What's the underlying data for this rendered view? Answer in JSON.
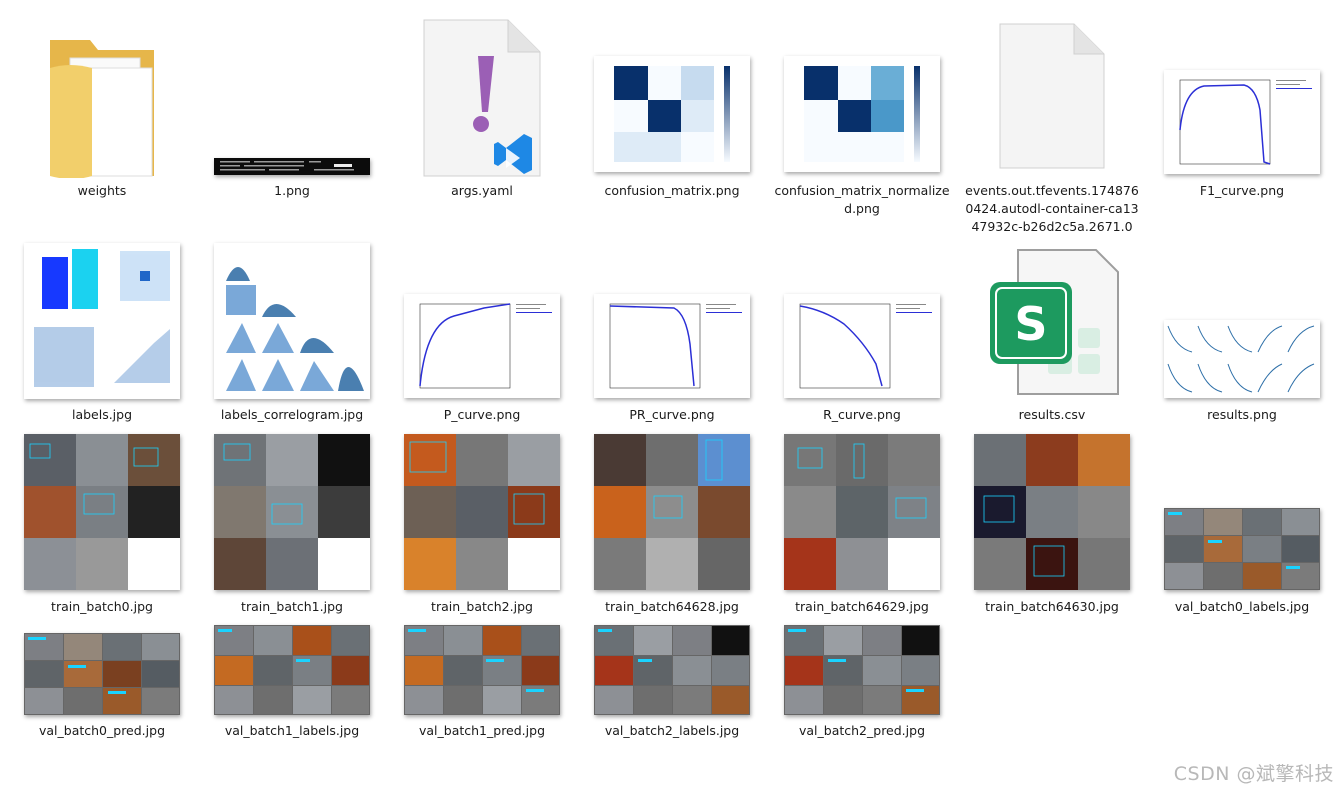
{
  "files": [
    {
      "key": "weights",
      "name": "weights",
      "icon": "folder-icon"
    },
    {
      "key": "img1",
      "name": "1.png",
      "icon": "terminal-screenshot-thumbnail"
    },
    {
      "key": "args",
      "name": "args.yaml",
      "icon": "yaml-file-icon"
    },
    {
      "key": "cm",
      "name": "confusion_matrix.png",
      "icon": "confusion-matrix-thumbnail"
    },
    {
      "key": "cmn",
      "name": "confusion_matrix_normalized.png",
      "icon": "confusion-matrix-normalized-thumbnail"
    },
    {
      "key": "events",
      "name": "events.out.tfevents.1748760424.autodl-container-ca1347932c-b26d2c5a.2671.0",
      "icon": "blank-file-icon"
    },
    {
      "key": "f1",
      "name": "F1_curve.png",
      "icon": "f1-curve-thumbnail"
    },
    {
      "key": "labels",
      "name": "labels.jpg",
      "icon": "labels-thumbnail"
    },
    {
      "key": "corr",
      "name": "labels_correlogram.jpg",
      "icon": "correlogram-thumbnail"
    },
    {
      "key": "p",
      "name": "P_curve.png",
      "icon": "p-curve-thumbnail"
    },
    {
      "key": "pr",
      "name": "PR_curve.png",
      "icon": "pr-curve-thumbnail"
    },
    {
      "key": "r",
      "name": "R_curve.png",
      "icon": "r-curve-thumbnail"
    },
    {
      "key": "csv",
      "name": "results.csv",
      "icon": "spreadsheet-file-icon"
    },
    {
      "key": "res",
      "name": "results.png",
      "icon": "results-thumbnail"
    },
    {
      "key": "tb0",
      "name": "train_batch0.jpg",
      "icon": "train-batch-thumbnail"
    },
    {
      "key": "tb1",
      "name": "train_batch1.jpg",
      "icon": "train-batch-thumbnail"
    },
    {
      "key": "tb2",
      "name": "train_batch2.jpg",
      "icon": "train-batch-thumbnail"
    },
    {
      "key": "tb64628",
      "name": "train_batch64628.jpg",
      "icon": "train-batch-thumbnail"
    },
    {
      "key": "tb64629",
      "name": "train_batch64629.jpg",
      "icon": "train-batch-thumbnail"
    },
    {
      "key": "tb64630",
      "name": "train_batch64630.jpg",
      "icon": "train-batch-thumbnail"
    },
    {
      "key": "vb0l",
      "name": "val_batch0_labels.jpg",
      "icon": "val-batch-thumbnail"
    },
    {
      "key": "vb0p",
      "name": "val_batch0_pred.jpg",
      "icon": "val-batch-thumbnail"
    },
    {
      "key": "vb1l",
      "name": "val_batch1_labels.jpg",
      "icon": "val-batch-thumbnail"
    },
    {
      "key": "vb1p",
      "name": "val_batch1_pred.jpg",
      "icon": "val-batch-thumbnail"
    },
    {
      "key": "vb2l",
      "name": "val_batch2_labels.jpg",
      "icon": "val-batch-thumbnail"
    },
    {
      "key": "vb2p",
      "name": "val_batch2_pred.jpg",
      "icon": "val-batch-thumbnail"
    }
  ],
  "watermark": "CSDN @斌擎科技",
  "colors": {
    "folder": "#f2cf6b",
    "yaml_mark": "#9b5fb5",
    "vscode": "#1e88e5",
    "spreadsheet": "#1d9a5f",
    "curve": "#2b2fd6",
    "matrix_dark": "#08306b"
  }
}
